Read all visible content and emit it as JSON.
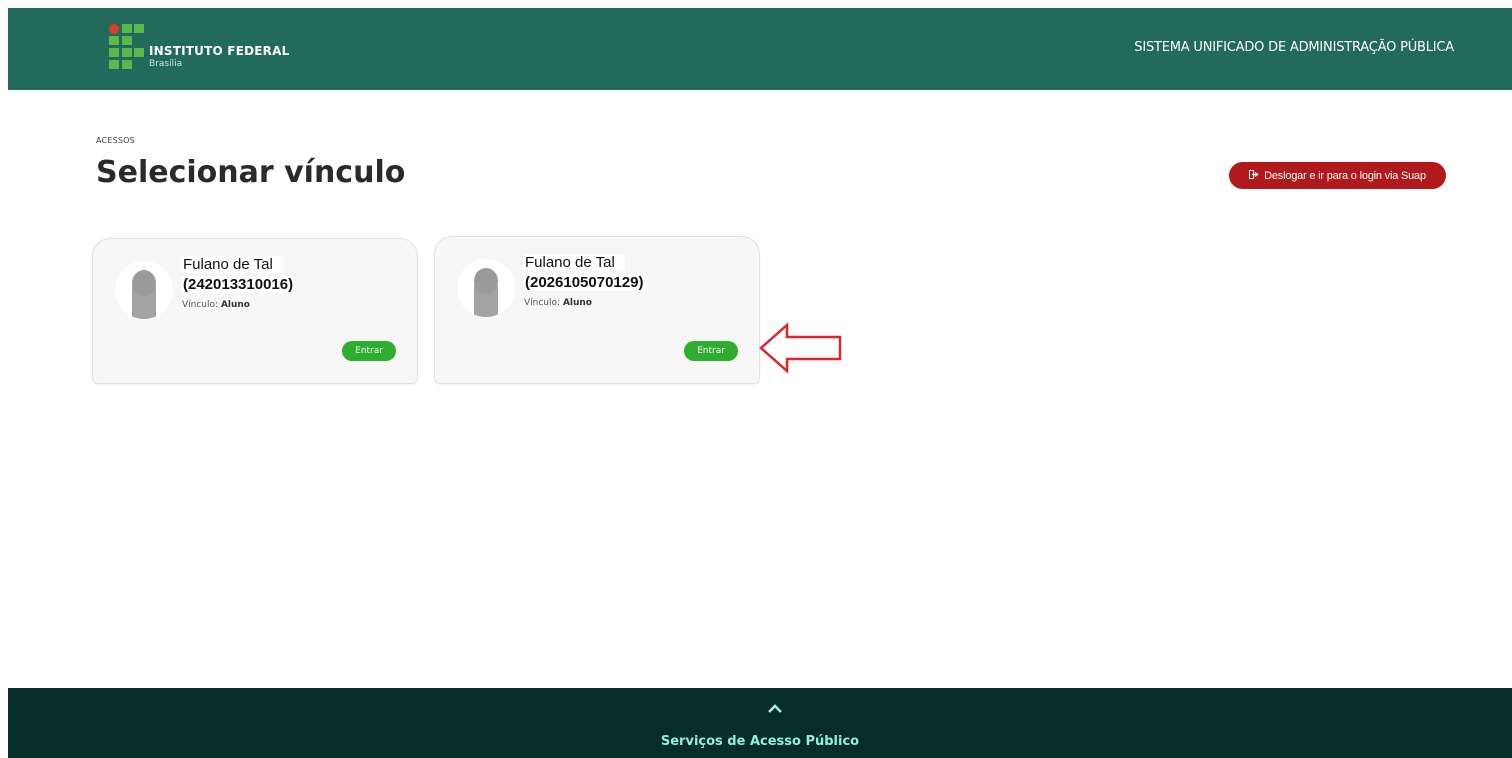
{
  "header": {
    "logo_title": "INSTITUTO FEDERAL",
    "logo_subtitle": "Brasília",
    "system_title": "SISTEMA UNIFICADO DE ADMINISTRAÇÃO PÚBLICA"
  },
  "breadcrumb": "ACESSOS",
  "page_title": "Selecionar vínculo",
  "logout_button": "Deslogar e ir para o login via Suap",
  "cards": [
    {
      "name": "Fulano de Tal",
      "id": "(242013310016)",
      "vinculo_label": "Vínculo:",
      "vinculo_value": "Aluno",
      "button": "Entrar"
    },
    {
      "name": "Fulano de Tal",
      "id": "(2026105070129)",
      "vinculo_label": "Vínculo:",
      "vinculo_value": "Aluno",
      "button": "Entrar"
    }
  ],
  "footer": {
    "label": "Serviços de Acesso Público"
  },
  "colors": {
    "header_bg": "#226a5b",
    "footer_bg": "#062d29",
    "logout_red": "#b1191d",
    "enter_green": "#2eae2e",
    "annotation_arrow": "#e0262a"
  },
  "icons": [
    "logo-icon",
    "logout-icon",
    "avatar-placeholder-icon",
    "chevron-up-icon",
    "annotation-arrow-icon"
  ]
}
